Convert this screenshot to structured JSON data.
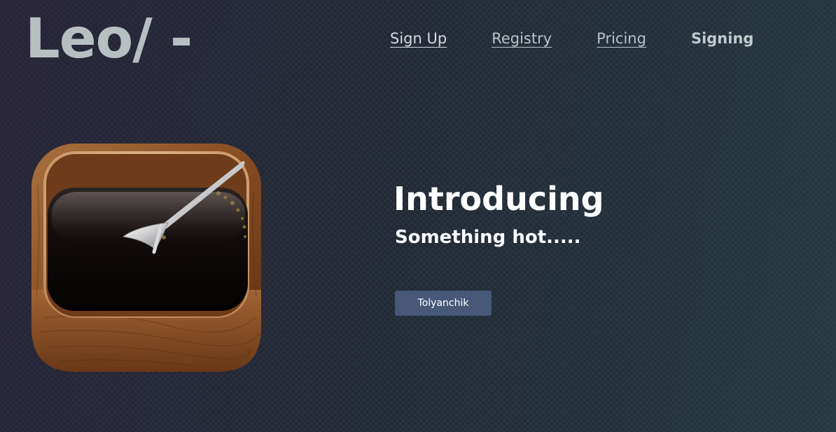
{
  "header": {
    "logo_text": "Leo/ -"
  },
  "nav": {
    "items": [
      {
        "label": "Sign Up"
      },
      {
        "label": "Registry"
      },
      {
        "label": "Pricing"
      },
      {
        "label": "Signing"
      }
    ]
  },
  "hero": {
    "icon": "coffee-cup-app-icon",
    "title": "Introducing",
    "subtitle": "Something hot.....",
    "button_label": "Tolyanchik"
  },
  "colors": {
    "background": "#2b3340",
    "logo": "#b7bfc1",
    "nav_text": "#b9c3c7",
    "button": "#475878",
    "hero_text": "#ffffff"
  }
}
